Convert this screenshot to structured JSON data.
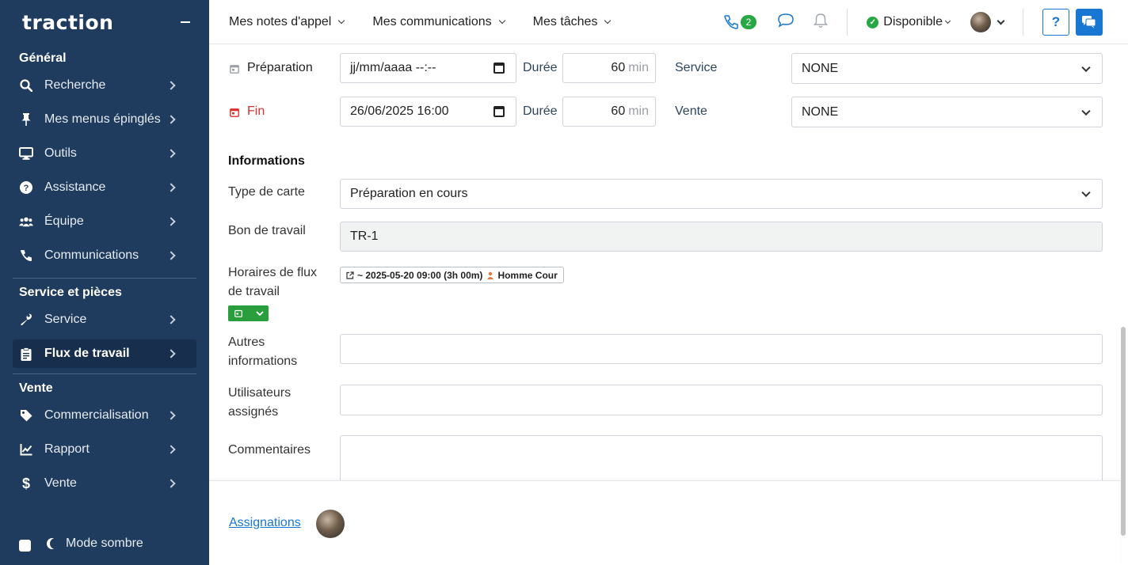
{
  "sidebar": {
    "logo": "traction",
    "sections": [
      {
        "title": "Général",
        "items": [
          {
            "label": "Recherche",
            "icon": "search-icon"
          },
          {
            "label": "Mes menus épinglés",
            "icon": "pin-icon"
          },
          {
            "label": "Outils",
            "icon": "monitor-icon"
          },
          {
            "label": "Assistance",
            "icon": "question-circle-icon"
          },
          {
            "label": "Équipe",
            "icon": "users-icon"
          },
          {
            "label": "Communications",
            "icon": "phone-icon"
          }
        ]
      },
      {
        "title": "Service et pièces",
        "items": [
          {
            "label": "Service",
            "icon": "wrench-icon"
          },
          {
            "label": "Flux de travail",
            "icon": "clipboard-icon",
            "active": true
          }
        ]
      },
      {
        "title": "Vente",
        "items": [
          {
            "label": "Commercialisation",
            "icon": "tag-icon"
          },
          {
            "label": "Rapport",
            "icon": "chart-line-icon"
          },
          {
            "label": "Vente",
            "icon": "dollar-icon"
          }
        ]
      }
    ],
    "dark_mode_label": "Mode sombre"
  },
  "topbar": {
    "menus": [
      "Mes notes d'appel",
      "Mes communications",
      "Mes tâches"
    ],
    "call_badge": "2",
    "status": "Disponible"
  },
  "form": {
    "preparation_label": "Préparation",
    "preparation_value": "jj/mm/aaaa --:--",
    "fin_label": "Fin",
    "fin_value": "26/06/2025 16:00",
    "duree_label": "Durée",
    "duree1_value": "60",
    "duree2_value": "60",
    "unit": "min",
    "service_label": "Service",
    "service_value": "NONE",
    "vente_label": "Vente",
    "vente_value": "NONE",
    "informations_title": "Informations",
    "type_carte_label": "Type de carte",
    "type_carte_value": "Préparation en cours",
    "bon_travail_label": "Bon de travail",
    "bon_travail_value": "TR-1",
    "horaires_label_1": "Horaires de flux",
    "horaires_label_2": "de travail",
    "horaire_tag_text": "~ 2025-05-20 09:00 (3h 00m)",
    "horaire_tag_user": "Homme Cour",
    "autres_label_1": "Autres",
    "autres_label_2": "informations",
    "utilisateurs_label_1": "Utilisateurs",
    "utilisateurs_label_2": "assignés",
    "commentaires_label": "Commentaires"
  },
  "footer": {
    "assignations_link": "Assignations"
  },
  "colors": {
    "sidebar_bg": "#1f3b5e",
    "accent_blue": "#1877d2",
    "green": "#28a745",
    "red": "#d9302c"
  }
}
